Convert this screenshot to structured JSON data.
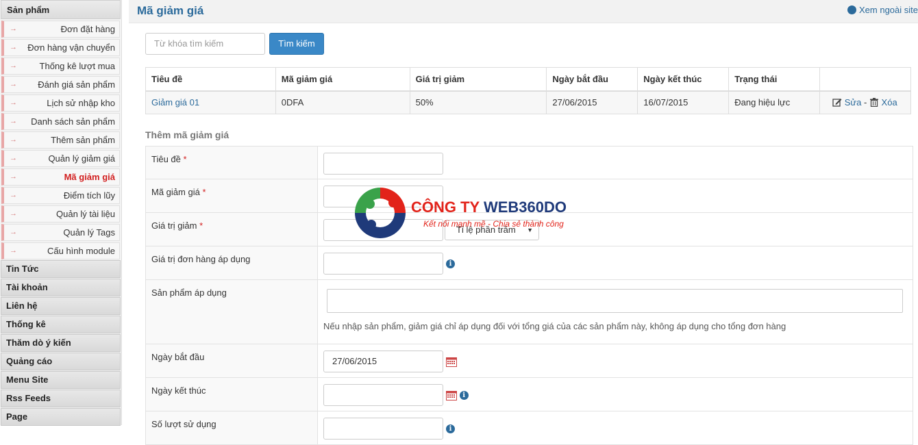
{
  "sidebar": {
    "top_group": "Sản phẩm",
    "sub_items": [
      {
        "label": "Đơn đặt hàng"
      },
      {
        "label": "Đơn hàng vận chuyển"
      },
      {
        "label": "Thống kê lượt mua"
      },
      {
        "label": "Đánh giá sản phẩm"
      },
      {
        "label": "Lịch sử nhập kho"
      },
      {
        "label": "Danh sách sản phẩm"
      },
      {
        "label": "Thêm sản phẩm"
      },
      {
        "label": "Quản lý giảm giá"
      },
      {
        "label": "Mã giảm giá"
      },
      {
        "label": "Điểm tích lũy"
      },
      {
        "label": "Quản lý tài liệu"
      },
      {
        "label": "Quản lý Tags"
      },
      {
        "label": "Cấu hình module"
      }
    ],
    "groups": [
      "Tin Tức",
      "Tài khoản",
      "Liên hệ",
      "Thống kê",
      "Thăm dò ý kiến",
      "Quảng cáo",
      "Menu Site",
      "Rss Feeds",
      "Page"
    ],
    "arrow_glyph": "→"
  },
  "header": {
    "title": "Mã giảm giá",
    "view_site": "Xem ngoài site"
  },
  "search": {
    "placeholder": "Từ khóa tìm kiếm",
    "button": "Tìm kiếm"
  },
  "table": {
    "columns": [
      "Tiêu đề",
      "Mã giảm giá",
      "Giá trị giảm",
      "Ngày bắt đầu",
      "Ngày kết thúc",
      "Trạng thái",
      ""
    ],
    "rows": [
      {
        "title": "Giảm giá 01",
        "code": "0DFA",
        "value": "50%",
        "start": "27/06/2015",
        "end": "16/07/2015",
        "status": "Đang hiệu lực",
        "edit": "Sửa",
        "sep": "-",
        "delete": "Xóa"
      }
    ]
  },
  "form": {
    "section_title": "Thêm mã giảm giá",
    "required_mark": "*",
    "labels": {
      "title": "Tiêu đề",
      "code": "Mã giảm giá",
      "value": "Giá trị giảm",
      "min_order": "Giá trị đơn hàng áp dụng",
      "products": "Sản phẩm áp dụng",
      "start": "Ngày bắt đầu",
      "end": "Ngày kết thúc",
      "usage": "Số lượt sử dụng"
    },
    "value_type": "Tỉ lệ phần trăm",
    "start_value": "27/06/2015",
    "products_hint": "Nếu nhập sản phẩm, giảm giá chỉ áp dụng đối với tổng giá của các sản phẩm này, không áp dụng cho tổng đơn hàng",
    "info_glyph": "i"
  },
  "watermark": {
    "company": "CÔNG TY ",
    "brand": "WEB360DO",
    "slogan": "Kết nối mạnh mẽ - Chia sẻ thành công"
  },
  "colors": {
    "accent": "#2b6a9b",
    "button": "#3a88c7",
    "active_menu": "#d21f1f",
    "required": "#d21f1f"
  }
}
